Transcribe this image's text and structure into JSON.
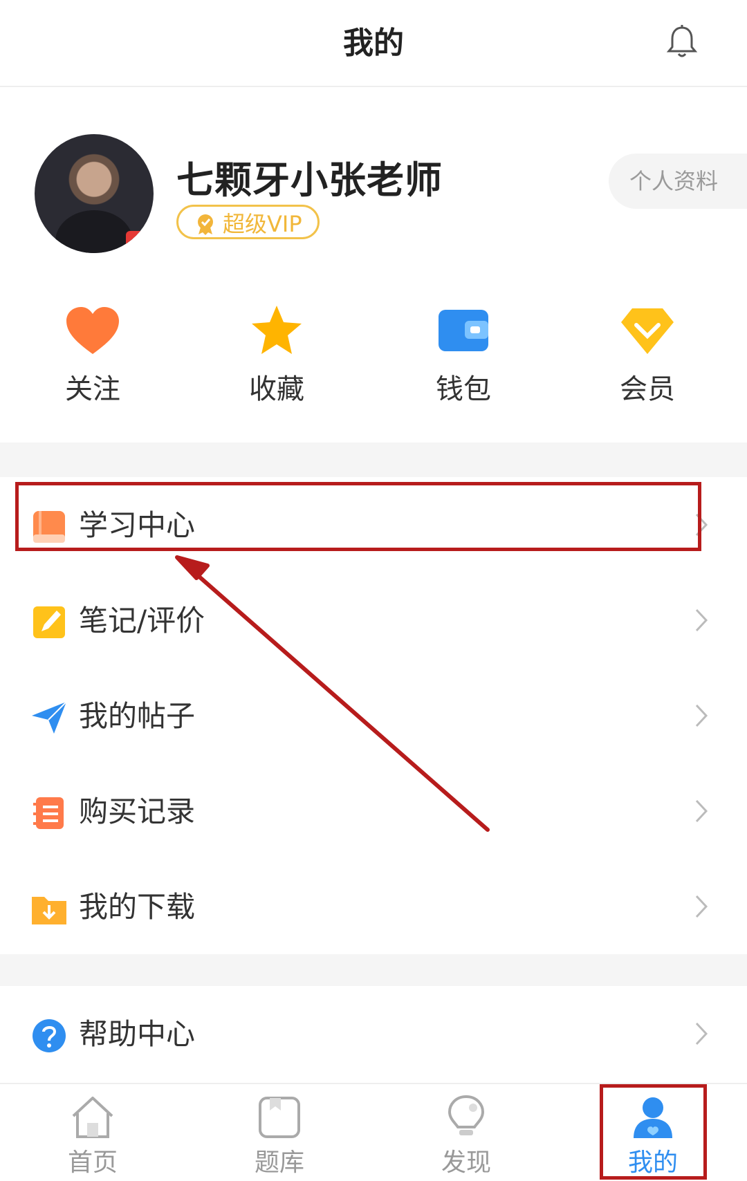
{
  "header": {
    "title": "我的",
    "bell_icon": "bell-icon"
  },
  "profile": {
    "name": "七颗牙小张老师",
    "vip_label": "超级VIP",
    "profile_button": "个人资料",
    "avatar": "avatar"
  },
  "quick_actions": [
    {
      "label": "关注",
      "icon": "heart-icon",
      "color": "#ff7a3a"
    },
    {
      "label": "收藏",
      "icon": "star-icon",
      "color": "#ffb400"
    },
    {
      "label": "钱包",
      "icon": "wallet-icon",
      "color": "#2f8ef0"
    },
    {
      "label": "会员",
      "icon": "diamond-icon",
      "color": "#ffc21a"
    }
  ],
  "menu": [
    {
      "label": "学习中心",
      "icon": "book-icon"
    },
    {
      "label": "笔记/评价",
      "icon": "note-pen-icon"
    },
    {
      "label": "我的帖子",
      "icon": "paper-plane-icon"
    },
    {
      "label": "购买记录",
      "icon": "receipt-icon"
    },
    {
      "label": "我的下载",
      "icon": "download-folder-icon"
    },
    {
      "label": "帮助中心",
      "icon": "question-icon"
    }
  ],
  "tabbar": [
    {
      "label": "首页",
      "icon": "home-icon",
      "active": false
    },
    {
      "label": "题库",
      "icon": "question-bank-icon",
      "active": false
    },
    {
      "label": "发现",
      "icon": "lightbulb-icon",
      "active": false
    },
    {
      "label": "我的",
      "icon": "user-icon",
      "active": true
    }
  ],
  "colors": {
    "accent": "#2f8ef0",
    "vip": "#f2c24a",
    "annotation": "#b71c1c"
  }
}
